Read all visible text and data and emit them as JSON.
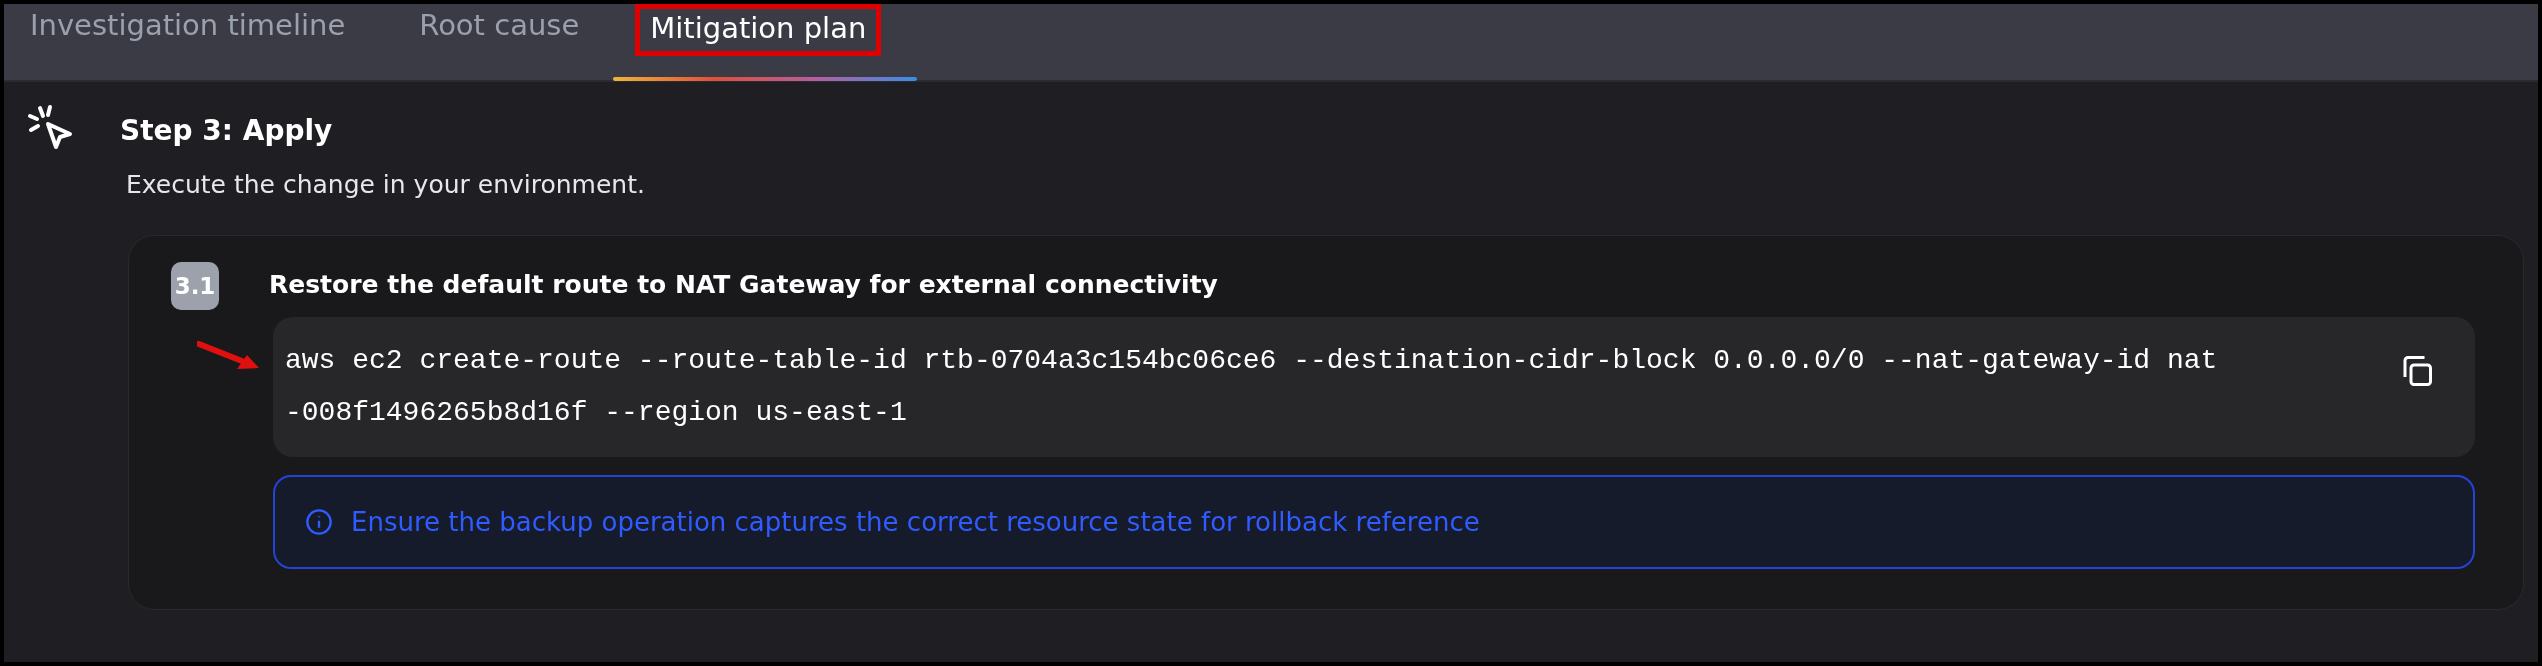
{
  "tabs": [
    {
      "label": "Investigation timeline",
      "selected": false,
      "highlighted": false
    },
    {
      "label": "Root cause",
      "selected": false,
      "highlighted": false
    },
    {
      "label": "Mitigation plan",
      "selected": true,
      "highlighted": true
    }
  ],
  "step": {
    "title": "Step 3: Apply",
    "description": "Execute the change in your environment.",
    "substeps": [
      {
        "number": "3.1",
        "title": "Restore the default route to NAT Gateway for external connectivity",
        "command": {
          "text": "aws ec2 create-route --route-table-id rtb-0704a3c154bc06ce6 --destination-cidr-block 0.0.0.0/0 --nat-gateway-id nat-008f1496265b8d16f --region us-east-1",
          "pointed_at": true
        },
        "note": "Ensure the backup operation captures the correct resource state for rollback reference"
      }
    ]
  }
}
